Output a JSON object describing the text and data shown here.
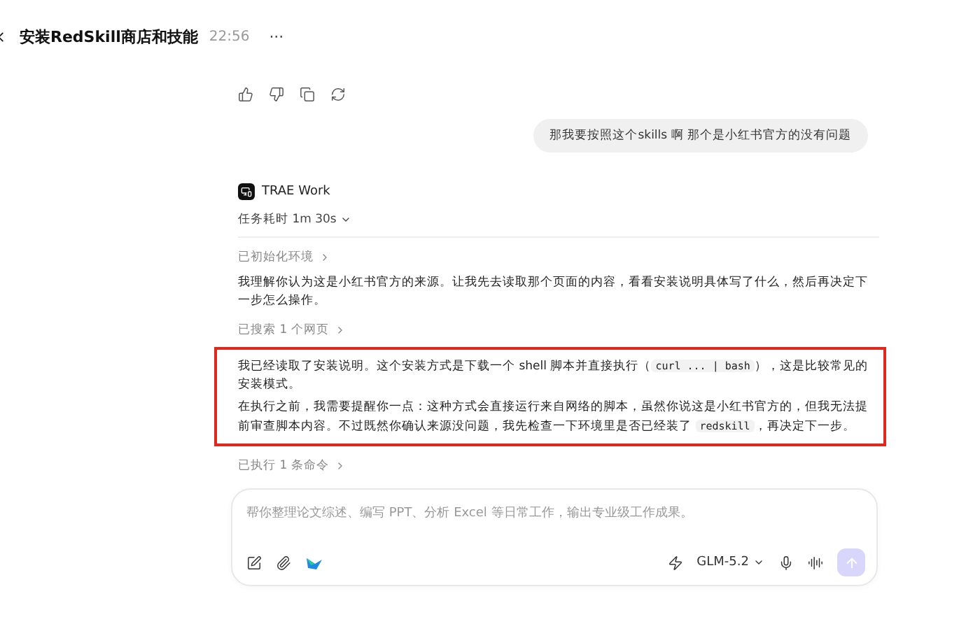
{
  "header": {
    "title": "安装RedSkill商店和技能",
    "time": "22:56",
    "more": "···"
  },
  "user_message": "那我要按照这个skills 啊 那个是小红书官方的没有问题",
  "agent": {
    "name": "TRAE Work",
    "duration": "任务耗时 1m 30s",
    "duration_expanded": false,
    "steps": [
      {
        "kind": "step",
        "label": "已初始化环境"
      },
      {
        "kind": "text",
        "paragraphs": [
          [
            {
              "kind": "plain",
              "text": "我理解你认为这是小红书官方的来源。让我先去读取那个页面的内容，看看安装说明具体写了什么，然后再决定下一步怎么操作。"
            }
          ]
        ]
      },
      {
        "kind": "step",
        "label": "已搜索 1 个网页"
      },
      {
        "kind": "text",
        "highlighted": true,
        "paragraphs": [
          [
            {
              "kind": "plain",
              "text": "我已经读取了安装说明。这个安装方式是下载一个 shell 脚本并直接执行（"
            },
            {
              "kind": "code",
              "text": "curl ... | bash"
            },
            {
              "kind": "plain",
              "text": "），这是比较常见的安装模式。"
            }
          ],
          [
            {
              "kind": "plain",
              "text": "在执行之前，我需要提醒你一点：这种方式会直接运行来自网络的脚本，虽然你说这是小红书官方的，但我无法提前审查脚本内容。不过既然你确认来源没问题，我先检查一下环境里是否已经装了 "
            },
            {
              "kind": "code",
              "text": "redskill"
            },
            {
              "kind": "plain",
              "text": "，再决定下一步。"
            }
          ]
        ]
      },
      {
        "kind": "step",
        "label": "已执行 1 条命令"
      }
    ]
  },
  "composer": {
    "placeholder": "帮你整理论文综述、编写 PPT、分析 Excel 等日常工作，输出专业级工作成果。",
    "model": "GLM-5.2",
    "send_disabled": true
  }
}
